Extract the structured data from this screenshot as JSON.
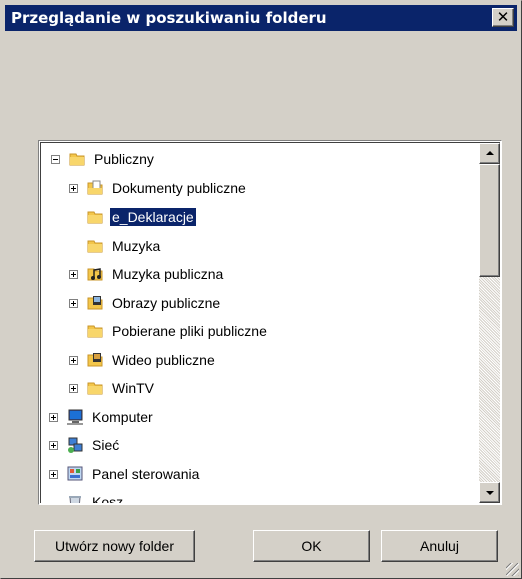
{
  "window": {
    "title": "Przeglądanie w poszukiwaniu folderu",
    "close_label": "✕"
  },
  "tree": {
    "items": [
      {
        "label": "Publiczny",
        "expander": "minus",
        "icon": "folder-icon",
        "selected": false
      },
      {
        "label": "Dokumenty publiczne",
        "expander": "plus",
        "icon": "documents-folder-icon",
        "selected": false
      },
      {
        "label": "e_Deklaracje",
        "expander": "none",
        "icon": "folder-icon",
        "selected": true
      },
      {
        "label": "Muzyka",
        "expander": "none",
        "icon": "folder-icon",
        "selected": false
      },
      {
        "label": "Muzyka publiczna",
        "expander": "plus",
        "icon": "music-folder-icon",
        "selected": false
      },
      {
        "label": "Obrazy publiczne",
        "expander": "plus",
        "icon": "pictures-folder-icon",
        "selected": false
      },
      {
        "label": "Pobierane pliki publiczne",
        "expander": "none",
        "icon": "folder-icon",
        "selected": false
      },
      {
        "label": "Wideo publiczne",
        "expander": "plus",
        "icon": "video-folder-icon",
        "selected": false
      },
      {
        "label": "WinTV",
        "expander": "plus",
        "icon": "folder-icon",
        "selected": false
      },
      {
        "label": "Komputer",
        "expander": "plus",
        "icon": "computer-icon",
        "selected": false
      },
      {
        "label": "Sieć",
        "expander": "plus",
        "icon": "network-icon",
        "selected": false
      },
      {
        "label": "Panel sterowania",
        "expander": "plus",
        "icon": "control-panel-icon",
        "selected": false
      },
      {
        "label": "Kosz",
        "expander": "none",
        "icon": "recycle-bin-icon",
        "selected": false
      }
    ]
  },
  "buttons": {
    "new_folder": "Utwórz nowy folder",
    "ok": "OK",
    "cancel": "Anuluj"
  },
  "colors": {
    "title_bar": "#0a246a",
    "selection": "#0a246a",
    "face": "#d4d0c8"
  }
}
